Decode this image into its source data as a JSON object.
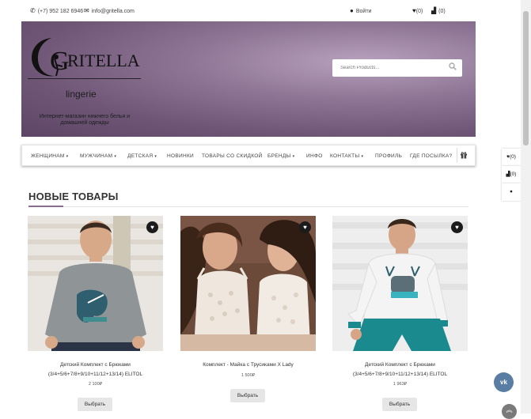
{
  "topbar": {
    "phone": "(+7) 952 182 6946",
    "email": "info@gritella.com",
    "login": "Войти",
    "wishlist_count": "(0)",
    "cart_count": "(0)"
  },
  "header": {
    "logo_text": "RITELLA",
    "logo_initial": "G",
    "subtitle": "lingerie",
    "tagline": "Интернет-магазин нижнего белья и домашней одежды",
    "search_placeholder": "Search Products..."
  },
  "nav": {
    "items": [
      {
        "label": "ЖЕНЩИНАМ",
        "dropdown": true
      },
      {
        "label": "МУЖЧИНАМ",
        "dropdown": true
      },
      {
        "label": "ДЕТСКАЯ",
        "dropdown": true
      },
      {
        "label": "НОВИНКИ",
        "dropdown": false
      },
      {
        "label": "ТОВАРЫ СО СКИДКОЙ",
        "dropdown": false
      },
      {
        "label": "БРЕНДЫ",
        "dropdown": true
      },
      {
        "label": "ИНФО",
        "dropdown": false
      },
      {
        "label": "КОНТАКТЫ",
        "dropdown": true
      },
      {
        "label": "ПРОФИЛЬ",
        "dropdown": false
      },
      {
        "label": "ГДЕ ПОСЫЛКА?",
        "dropdown": false
      }
    ]
  },
  "section": {
    "title": "НОВЫЕ ТОВАРЫ"
  },
  "products": [
    {
      "name_line1": "Детский Комплект с Брюками",
      "name_line2": "(3/4+5/6+7/8+9/10+11/12+13/14) ELITOL",
      "price": "2 100₽",
      "button": "Выбрать"
    },
    {
      "name_line1": "Комплект - Майка с Трусиками X Lady",
      "name_line2": "",
      "price": "1 500₽",
      "button": "Выбрать"
    },
    {
      "name_line1": "Детский Комплект с Брюками",
      "name_line2": "(3/4+5/6+7/8+9/10+11/12+13/14) ELITOL",
      "price": "1 963₽",
      "button": "Выбрать"
    }
  ],
  "side_tools": {
    "wishlist": "(0)",
    "cart": "(0)"
  },
  "social": {
    "vk": "vk"
  },
  "colors": {
    "banner": "#8f7696",
    "accent": "#8a6d91",
    "vk": "#5a7ea3"
  }
}
